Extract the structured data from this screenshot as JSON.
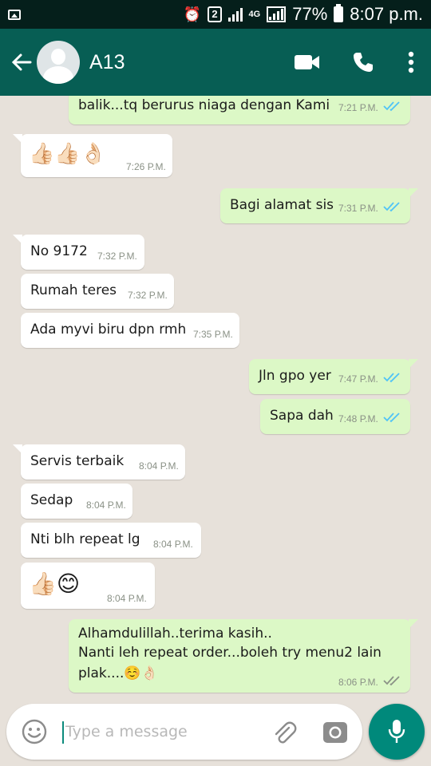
{
  "status_bar": {
    "sim_badge": "2",
    "network": "4G",
    "battery": "77%",
    "time": "8:07 p.m."
  },
  "header": {
    "contact_name": "A13"
  },
  "input": {
    "placeholder": "Type a message"
  },
  "messages": [
    {
      "dir": "out",
      "text": "balik...tq berurus niaga dengan Kami",
      "time": "7:21 P.M."
    },
    {
      "dir": "in",
      "text": "👍🏻👍🏻👌🏻",
      "time": "7:26 P.M."
    },
    {
      "dir": "out",
      "text": "Bagi alamat sis",
      "time": "7:31 P.M."
    },
    {
      "dir": "in",
      "text": "No 9172",
      "time": "7:32 P.M."
    },
    {
      "dir": "in",
      "text": "Rumah teres",
      "time": "7:32 P.M."
    },
    {
      "dir": "in",
      "text": "Ada myvi biru dpn rmh",
      "time": "7:35 P.M."
    },
    {
      "dir": "out",
      "text": "Jln gpo yer",
      "time": "7:47 P.M."
    },
    {
      "dir": "out",
      "text": "Sapa dah",
      "time": "7:48 P.M."
    },
    {
      "dir": "in",
      "text": "Servis terbaik",
      "time": "8:04 P.M."
    },
    {
      "dir": "in",
      "text": "Sedap",
      "time": "8:04 P.M."
    },
    {
      "dir": "in",
      "text": "Nti blh repeat lg",
      "time": "8:04 P.M."
    },
    {
      "dir": "in",
      "text": "👍🏻😊",
      "time": "8:04 P.M."
    },
    {
      "dir": "out",
      "line1": "Alhamdulillah..terima kasih..",
      "line2": "Nanti leh repeat order...boleh try menu2 lain",
      "line3": "plak....☺️👌🏻",
      "time": "8:06 P.M."
    }
  ]
}
